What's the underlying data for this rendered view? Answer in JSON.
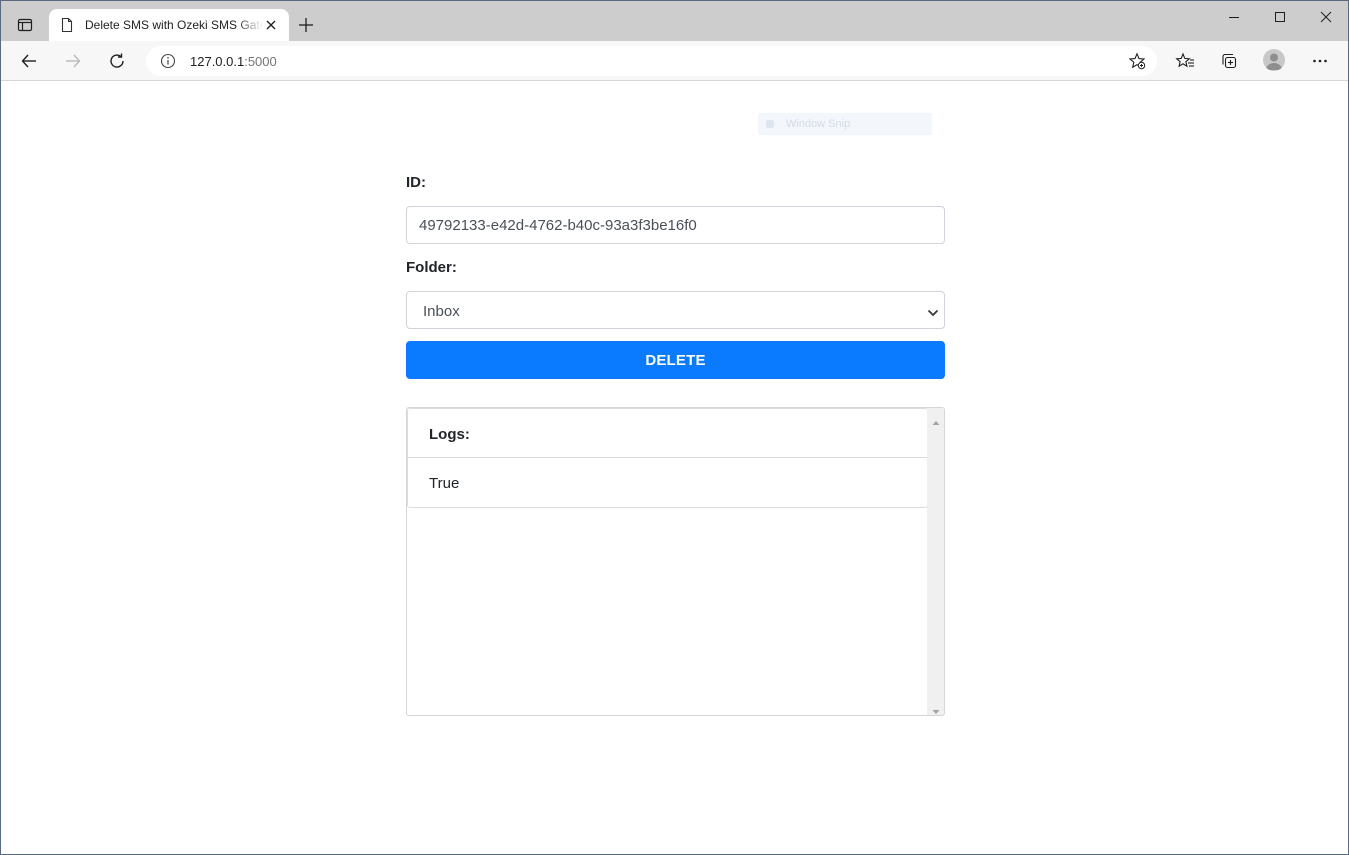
{
  "browser": {
    "tab": {
      "title": "Delete SMS with Ozeki SMS Gateway"
    },
    "address": {
      "host": "127.0.0.1",
      "port": ":5000"
    },
    "icons": [
      "tab-actions-icon",
      "document-icon",
      "close-icon",
      "plus-icon",
      "minimize-icon",
      "maximize-icon",
      "close-window-icon",
      "back-icon",
      "forward-icon",
      "refresh-icon",
      "info-icon",
      "add-favorite-icon",
      "favorites-icon",
      "collections-icon",
      "profile-icon",
      "more-icon"
    ]
  },
  "snip": {
    "label": "Window Snip"
  },
  "form": {
    "id_label": "ID:",
    "id_value": "49792133-e42d-4762-b40c-93a3f3be16f0",
    "folder_label": "Folder:",
    "folder_selected": "Inbox",
    "delete_button": "DELETE"
  },
  "logs": {
    "title": "Logs:",
    "entries": [
      "True"
    ]
  },
  "colors": {
    "accent": "#0a7bff",
    "tabstrip": "#cdcdcd",
    "toolbar": "#f7f7f7"
  }
}
